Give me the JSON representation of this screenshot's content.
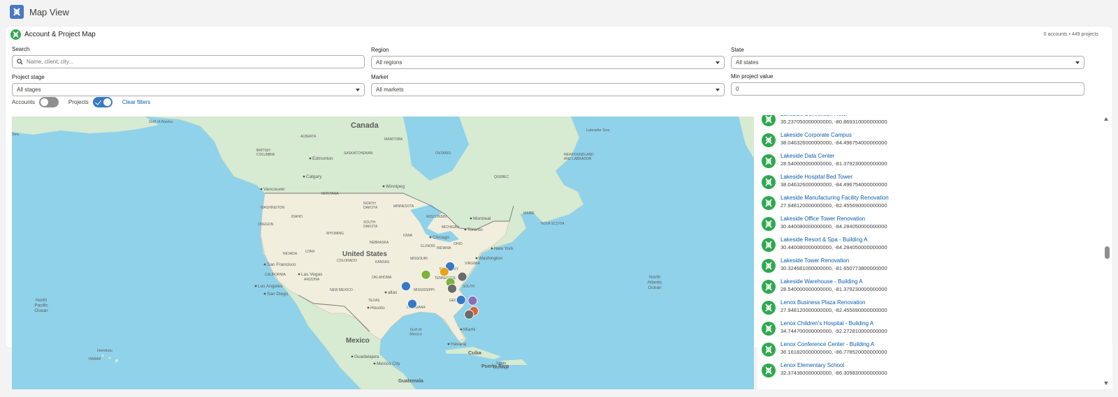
{
  "app": {
    "title": "Map View"
  },
  "card": {
    "title": "Account & Project Map",
    "count": "0 accounts • 449 projects"
  },
  "filters": {
    "search": {
      "label": "Search",
      "placeholder": "Name, client, city..."
    },
    "region": {
      "label": "Region",
      "value": "All regions"
    },
    "state": {
      "label": "State",
      "value": "All states"
    },
    "project_stage": {
      "label": "Project stage",
      "value": "All stages"
    },
    "market": {
      "label": "Market",
      "value": "All markets"
    },
    "min_project_value": {
      "label": "Min project value",
      "value": "0"
    }
  },
  "toggles": {
    "accounts": {
      "label": "Accounts",
      "on": false
    },
    "projects": {
      "label": "Projects",
      "on": true
    },
    "clear_label": "Clear filters"
  },
  "map": {
    "labels": {
      "canada": "Canada",
      "united_states": "United States",
      "mexico": "Mexico",
      "cuba": "Cuba",
      "gulf_of_alaska": "Gulf of Alaska",
      "labrador_sea": "Labrador Sea",
      "north_pacific": "North\nPacific\nOcean",
      "north_atlantic": "North\nAtlantic\nOcean",
      "gulf_of_mexico": "Gulf of\nMexico",
      "guatemala": "Guatemala",
      "puerto_rico": "Puerto Rico",
      "santo_domingo": "Santo\nDomingo",
      "sea": "Sea",
      "honolulu": "Honolulu",
      "hawaii": "HAWAII",
      "alberta": "ALBERTA",
      "british_columbia": "BRITISH\nCOLUMBIA",
      "saskatchewan": "SASKATCHEWAN",
      "manitoba": "MANITOBA",
      "ontario": "ONTARIO",
      "quebec": "QUEBEC",
      "newfoundland": "NEWFOUNDLAND\nAND LABRADOR",
      "nova_scotia": "NOVA SCOTIA",
      "washington": "WASHINGTON",
      "oregon": "OREGON",
      "idaho": "IDAHO",
      "montana": "MONTANA",
      "wyoming": "WYOMING",
      "nevada": "NEVADA",
      "california": "CALIFORNIA",
      "utah": "UTAH",
      "colorado": "COLORADO",
      "arizona": "ARIZONA",
      "new_mexico": "NEW MEXICO",
      "texas": "TEXAS",
      "oklahoma": "OKLAHOMA",
      "kansas": "KANSAS",
      "nebraska": "NEBRASKA",
      "south_dakota": "SOUTH\nDAKOTA",
      "north_dakota": "NORTH\nDAKOTA",
      "minnesota": "MINNESOTA",
      "iowa": "IOWA",
      "missouri": "MISSOURI",
      "wisconsin": "WISCONSIN",
      "michigan": "MICHIGAN",
      "illinois": "ILLINOIS",
      "indiana": "INDIANA",
      "ohio": "OHIO",
      "kentucky": "KENTUCKY",
      "tennessee": "TENNESSEE",
      "mississippi": "MISSISSIPPI",
      "louisiana": "LOUISIANA",
      "georgia": "GEORGIA",
      "virginia": "VIRGINIA",
      "south_carolina": "SOUTH",
      "maine": "MAINE",
      "cities": {
        "vancouver": "Vancouver",
        "edmonton": "Edmonton",
        "calgary": "Calgary",
        "winnipeg": "Winnipeg",
        "toronto": "Toronto",
        "montreal": "Montreal",
        "chicago": "Chicago",
        "new_york": "New York",
        "washington_dc": "Washington",
        "san_francisco": "San Francisco",
        "las_vegas": "Las Vegas",
        "los_angeles": "Los Angeles",
        "san_diego": "San Diego",
        "dallas": "allas",
        "houston": "Housto",
        "miami": "Miami",
        "havana": "Havana",
        "guadalajara": "Guadalajara",
        "mexico_city": "Mexico City"
      }
    },
    "markers": [
      {
        "lat": 36.16,
        "lng": -86.78,
        "color": "#3779c4"
      },
      {
        "lat": 35.24,
        "lng": -88.1,
        "color": "#e8a418"
      },
      {
        "lat": 34.75,
        "lng": -92.27,
        "color": "#7bb33b"
      },
      {
        "lat": 34.4,
        "lng": -84.0,
        "color": "#6b6b6b"
      },
      {
        "lat": 33.45,
        "lng": -86.7,
        "color": "#7bb33b"
      },
      {
        "lat": 32.78,
        "lng": -96.8,
        "color": "#3779c4"
      },
      {
        "lat": 32.37,
        "lng": -86.31,
        "color": "#6b6b6b"
      },
      {
        "lat": 30.44,
        "lng": -84.28,
        "color": "#3779c4"
      },
      {
        "lat": 30.32,
        "lng": -81.65,
        "color": "#8b6fb6"
      },
      {
        "lat": 29.76,
        "lng": -95.37,
        "color": "#3779c4"
      },
      {
        "lat": 28.54,
        "lng": -81.38,
        "color": "#d9663a"
      },
      {
        "lat": 27.95,
        "lng": -82.46,
        "color": "#6b6b6b"
      }
    ]
  },
  "list": {
    "items": [
      {
        "name": "Lakeside Convention Hotel",
        "coords": "35.237050000000000, -80.869310000000000"
      },
      {
        "name": "Lakeside Corporate Campus",
        "coords": "38.046326000000000, -84.496754000000000"
      },
      {
        "name": "Lakeside Data Center",
        "coords": "28.540000000000000, -81.379230000000000"
      },
      {
        "name": "Lakeside Hospital Bed Tower",
        "coords": "38.046326000000000, -84.496754000000000"
      },
      {
        "name": "Lakeside Manufacturing Facility Renovation",
        "coords": "27.948120000000000, -82.455690000000000"
      },
      {
        "name": "Lakeside Office Tower Renovation",
        "coords": "30.440080000000000, -84.284050000000000"
      },
      {
        "name": "Lakeside Resort & Spa - Building A",
        "coords": "30.440080000000000, -84.284050000000000"
      },
      {
        "name": "Lakeside Tower Renovation",
        "coords": "30.324681000000000, -81.650773800000000"
      },
      {
        "name": "Lakeside Warehouse - Building A",
        "coords": "28.540000000000000, -81.379230000000000"
      },
      {
        "name": "Lenox Business Plaza Renovation",
        "coords": "27.948120000000000, -82.455690000000000"
      },
      {
        "name": "Lenox Children's Hospital - Building A",
        "coords": "34.744700000000000, -92.272810000000000"
      },
      {
        "name": "Lenox Conference Center - Building A",
        "coords": "36.161820000000000, -86.778520000000000"
      },
      {
        "name": "Lenox Elementary School",
        "coords": "32.374360000000000, -86.309830000000000"
      }
    ]
  }
}
